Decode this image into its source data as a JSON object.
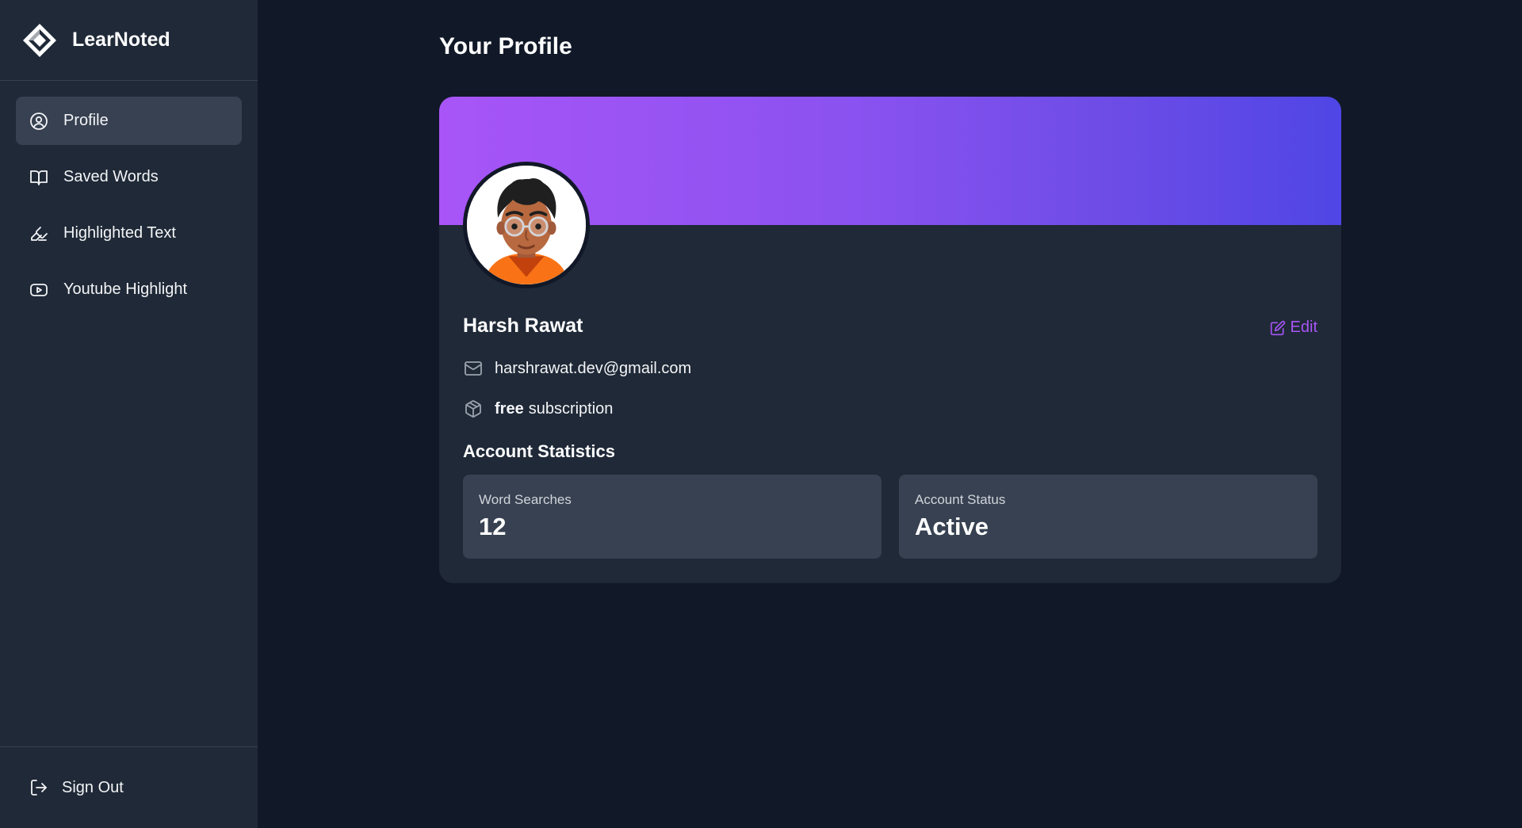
{
  "brand": {
    "name": "LearNoted"
  },
  "sidebar": {
    "items": [
      {
        "label": "Profile",
        "icon": "user-circle-icon",
        "active": true
      },
      {
        "label": "Saved Words",
        "icon": "book-open-icon",
        "active": false
      },
      {
        "label": "Highlighted Text",
        "icon": "highlighter-icon",
        "active": false
      },
      {
        "label": "Youtube Highlight",
        "icon": "youtube-icon",
        "active": false
      }
    ],
    "sign_out": {
      "label": "Sign Out",
      "icon": "log-out-icon"
    }
  },
  "main": {
    "title": "Your Profile",
    "profile": {
      "name": "Harsh Rawat",
      "edit_label": "Edit",
      "email": "harshrawat.dev@gmail.com",
      "subscription_plan": "free",
      "subscription_suffix": "subscription"
    },
    "stats": {
      "title": "Account Statistics",
      "items": [
        {
          "label": "Word Searches",
          "value": "12"
        },
        {
          "label": "Account Status",
          "value": "Active"
        }
      ]
    }
  },
  "colors": {
    "background": "#111827",
    "sidebar": "#1f2937",
    "accent": "#a855f7",
    "banner_start": "#a855f7",
    "banner_end": "#4f46e5"
  }
}
